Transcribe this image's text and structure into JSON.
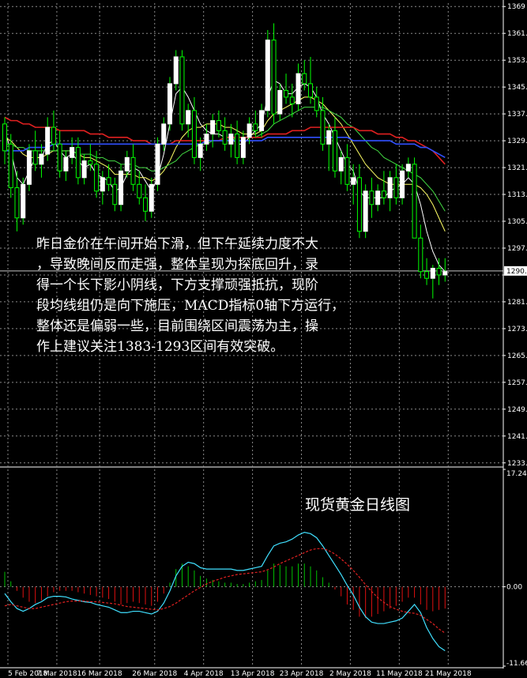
{
  "chart_data": [
    {
      "type": "candlestick",
      "instrument": "XAUUSD",
      "timeframe": "D1",
      "y_axis_ticks": [
        1369,
        1361,
        1353,
        1345,
        1337,
        1329,
        1321,
        1313,
        1305,
        1297,
        1289,
        1281,
        1273,
        1265,
        1257,
        1249,
        1241,
        1233
      ],
      "y_tick_labels": [
        "1369",
        "1361.",
        "1353.",
        "1345.",
        "1337.",
        "1329.",
        "1321.",
        "1313.",
        "1305.",
        "1297.",
        "",
        "1281.",
        "1273.",
        "1265.",
        "1257.",
        "1249.",
        "1241.",
        "1233."
      ],
      "ylim": [
        1232,
        1370
      ],
      "current_price": 1290.2,
      "current_price_label": "1290.",
      "x_tick_labels": [
        "5 Feb 2018",
        "7 Mar 2018",
        "16 Mar 2018",
        "26 Mar 2018",
        "4 Apr 2018",
        "13 Apr 2018",
        "23 Apr 2018",
        "2 May 2018",
        "11 May 2018",
        "21 May 2018"
      ],
      "candles_ohlc": [
        [
          1334,
          1336,
          1322,
          1326
        ],
        [
          1328,
          1331,
          1312,
          1315
        ],
        [
          1315,
          1320,
          1302,
          1306
        ],
        [
          1306,
          1318,
          1304,
          1316
        ],
        [
          1316,
          1328,
          1314,
          1326
        ],
        [
          1326,
          1332,
          1320,
          1322
        ],
        [
          1322,
          1328,
          1318,
          1325
        ],
        [
          1325,
          1336,
          1323,
          1333
        ],
        [
          1333,
          1338,
          1326,
          1328
        ],
        [
          1328,
          1332,
          1318,
          1320
        ],
        [
          1320,
          1326,
          1317,
          1324
        ],
        [
          1324,
          1330,
          1322,
          1327
        ],
        [
          1327,
          1330,
          1316,
          1318
        ],
        [
          1318,
          1325,
          1316,
          1323
        ],
        [
          1323,
          1328,
          1320,
          1322
        ],
        [
          1322,
          1326,
          1312,
          1314
        ],
        [
          1314,
          1320,
          1310,
          1318
        ],
        [
          1318,
          1322,
          1314,
          1316
        ],
        [
          1316,
          1318,
          1308,
          1310
        ],
        [
          1310,
          1322,
          1308,
          1320
        ],
        [
          1320,
          1326,
          1318,
          1324
        ],
        [
          1324,
          1328,
          1314,
          1316
        ],
        [
          1316,
          1320,
          1310,
          1312
        ],
        [
          1312,
          1316,
          1305,
          1308
        ],
        [
          1308,
          1318,
          1306,
          1316
        ],
        [
          1316,
          1330,
          1314,
          1328
        ],
        [
          1328,
          1336,
          1326,
          1334
        ],
        [
          1334,
          1348,
          1332,
          1346
        ],
        [
          1346,
          1356,
          1344,
          1354
        ],
        [
          1354,
          1356,
          1332,
          1334
        ],
        [
          1334,
          1340,
          1330,
          1338
        ],
        [
          1338,
          1342,
          1322,
          1324
        ],
        [
          1324,
          1330,
          1320,
          1328
        ],
        [
          1328,
          1334,
          1326,
          1331
        ],
        [
          1331,
          1337,
          1327,
          1335
        ],
        [
          1335,
          1338,
          1330,
          1332
        ],
        [
          1332,
          1336,
          1326,
          1328
        ],
        [
          1328,
          1334,
          1324,
          1331
        ],
        [
          1331,
          1335,
          1322,
          1324
        ],
        [
          1324,
          1332,
          1322,
          1330
        ],
        [
          1330,
          1336,
          1328,
          1334
        ],
        [
          1334,
          1338,
          1330,
          1332
        ],
        [
          1332,
          1340,
          1330,
          1338
        ],
        [
          1338,
          1362,
          1336,
          1359
        ],
        [
          1359,
          1364,
          1334,
          1337
        ],
        [
          1337,
          1346,
          1335,
          1344
        ],
        [
          1344,
          1349,
          1340,
          1342
        ],
        [
          1342,
          1346,
          1336,
          1340
        ],
        [
          1340,
          1352,
          1338,
          1349
        ],
        [
          1349,
          1353,
          1344,
          1346
        ],
        [
          1346,
          1354,
          1340,
          1342
        ],
        [
          1342,
          1345,
          1336,
          1338
        ],
        [
          1338,
          1342,
          1326,
          1328
        ],
        [
          1328,
          1334,
          1320,
          1332
        ],
        [
          1332,
          1336,
          1318,
          1320
        ],
        [
          1320,
          1326,
          1316,
          1324
        ],
        [
          1324,
          1328,
          1314,
          1316
        ],
        [
          1316,
          1322,
          1310,
          1318
        ],
        [
          1318,
          1322,
          1300,
          1302
        ],
        [
          1302,
          1316,
          1300,
          1314
        ],
        [
          1314,
          1318,
          1306,
          1310
        ],
        [
          1310,
          1316,
          1308,
          1314
        ],
        [
          1314,
          1320,
          1310,
          1312
        ],
        [
          1312,
          1320,
          1308,
          1318
        ],
        [
          1318,
          1322,
          1310,
          1312
        ],
        [
          1312,
          1322,
          1310,
          1320
        ],
        [
          1320,
          1324,
          1318,
          1322
        ],
        [
          1322,
          1324,
          1302,
          1300
        ],
        [
          1300,
          1304,
          1288,
          1290
        ],
        [
          1290,
          1294,
          1286,
          1288
        ],
        [
          1288,
          1292,
          1282,
          1291
        ],
        [
          1291,
          1294,
          1286,
          1289
        ],
        [
          1289,
          1294,
          1287,
          1290
        ]
      ],
      "ma_series": [
        {
          "color": "#ffffff",
          "values": [
            1332,
            1326,
            1318,
            1316,
            1320,
            1324,
            1324,
            1328,
            1329,
            1326,
            1324,
            1325,
            1323,
            1321,
            1322,
            1319,
            1318,
            1317,
            1314,
            1315,
            1319,
            1321,
            1320,
            1317,
            1314,
            1318,
            1325,
            1334,
            1343,
            1345,
            1342,
            1338,
            1334,
            1332,
            1331,
            1331,
            1330,
            1330,
            1328,
            1328,
            1330,
            1332,
            1334,
            1342,
            1347,
            1346,
            1343,
            1343,
            1345,
            1346,
            1345,
            1342,
            1337,
            1334,
            1330,
            1326,
            1322,
            1320,
            1314,
            1312,
            1312,
            1312,
            1312,
            1314,
            1315,
            1316,
            1318,
            1316,
            1310,
            1302,
            1296,
            1292,
            1290
          ]
        },
        {
          "color": "#ffff66",
          "values": [
            1330,
            1329,
            1327,
            1325,
            1324,
            1324,
            1324,
            1325,
            1326,
            1326,
            1326,
            1326,
            1325,
            1324,
            1324,
            1323,
            1322,
            1321,
            1319,
            1319,
            1319,
            1319,
            1318,
            1318,
            1317,
            1318,
            1320,
            1323,
            1327,
            1330,
            1332,
            1333,
            1333,
            1334,
            1334,
            1334,
            1333,
            1333,
            1332,
            1331,
            1331,
            1331,
            1332,
            1335,
            1337,
            1338,
            1339,
            1340,
            1341,
            1342,
            1342,
            1341,
            1340,
            1338,
            1336,
            1334,
            1331,
            1328,
            1325,
            1322,
            1320,
            1318,
            1317,
            1316,
            1316,
            1316,
            1316,
            1316,
            1315,
            1313,
            1310,
            1306,
            1302
          ]
        },
        {
          "color": "#44dd44",
          "values": [
            1328,
            1328,
            1327,
            1327,
            1326,
            1326,
            1326,
            1326,
            1326,
            1326,
            1326,
            1326,
            1325,
            1325,
            1325,
            1324,
            1324,
            1323,
            1323,
            1322,
            1322,
            1322,
            1321,
            1321,
            1320,
            1320,
            1321,
            1322,
            1323,
            1325,
            1326,
            1327,
            1328,
            1328,
            1329,
            1329,
            1329,
            1329,
            1330,
            1330,
            1330,
            1330,
            1331,
            1332,
            1334,
            1335,
            1336,
            1337,
            1338,
            1339,
            1339,
            1339,
            1339,
            1338,
            1337,
            1336,
            1334,
            1333,
            1331,
            1329,
            1327,
            1326,
            1324,
            1323,
            1322,
            1321,
            1320,
            1319,
            1318,
            1316,
            1314,
            1311,
            1308
          ]
        },
        {
          "color": "#e02020",
          "values": [
            1336,
            1335,
            1335,
            1334,
            1334,
            1333,
            1333,
            1333,
            1333,
            1332,
            1332,
            1332,
            1332,
            1332,
            1331,
            1331,
            1331,
            1330,
            1330,
            1330,
            1330,
            1329,
            1329,
            1329,
            1328,
            1328,
            1328,
            1328,
            1329,
            1329,
            1329,
            1329,
            1329,
            1329,
            1329,
            1329,
            1330,
            1330,
            1330,
            1330,
            1330,
            1330,
            1330,
            1331,
            1331,
            1331,
            1331,
            1332,
            1332,
            1332,
            1333,
            1333,
            1333,
            1333,
            1333,
            1333,
            1333,
            1333,
            1332,
            1332,
            1332,
            1331,
            1331,
            1331,
            1330,
            1330,
            1329,
            1329,
            1328,
            1327,
            1326,
            1324,
            1322
          ]
        },
        {
          "color": "#3050ff",
          "values": [
            1326,
            1326,
            1326,
            1326,
            1327,
            1327,
            1327,
            1327,
            1328,
            1328,
            1328,
            1328,
            1328,
            1328,
            1328,
            1328,
            1328,
            1328,
            1328,
            1328,
            1328,
            1328,
            1328,
            1328,
            1328,
            1328,
            1328,
            1328,
            1328,
            1328,
            1328,
            1328,
            1328,
            1329,
            1329,
            1329,
            1329,
            1329,
            1329,
            1329,
            1329,
            1329,
            1329,
            1330,
            1330,
            1330,
            1330,
            1330,
            1330,
            1330,
            1330,
            1330,
            1330,
            1330,
            1330,
            1330,
            1330,
            1329,
            1329,
            1329,
            1329,
            1329,
            1329,
            1329,
            1328,
            1328,
            1328,
            1328,
            1327,
            1327,
            1326,
            1325,
            1324
          ]
        }
      ]
    },
    {
      "type": "macd",
      "y_tick_labels": [
        "17.24",
        "0.00",
        "-11.66"
      ],
      "ylim": [
        -11.66,
        17.24
      ],
      "histogram": [
        2.2,
        0.8,
        -0.6,
        -1.6,
        -2.2,
        -2.4,
        -2.0,
        -1.4,
        -0.8,
        -0.6,
        -0.6,
        -0.6,
        -0.8,
        -1.0,
        -1.2,
        -1.4,
        -1.6,
        -1.8,
        -2.2,
        -2.6,
        -2.4,
        -2.2,
        -2.4,
        -2.6,
        -2.8,
        -2.2,
        -1.0,
        0.6,
        2.6,
        3.4,
        3.0,
        2.4,
        1.6,
        1.2,
        1.0,
        0.8,
        0.6,
        0.6,
        0.4,
        0.4,
        0.6,
        0.8,
        1.0,
        2.4,
        3.4,
        3.2,
        3.0,
        3.0,
        3.4,
        3.4,
        3.0,
        2.4,
        1.4,
        0.6,
        -0.4,
        -1.4,
        -2.6,
        -3.4,
        -4.4,
        -4.6,
        -4.4,
        -4.0,
        -3.6,
        -3.2,
        -2.8,
        -2.2,
        -1.6,
        -1.6,
        -2.6,
        -3.4,
        -3.6,
        -3.4,
        -3.2
      ],
      "macd_line": [
        -1.0,
        -2.2,
        -3.2,
        -3.6,
        -3.2,
        -2.6,
        -2.2,
        -1.6,
        -1.4,
        -1.4,
        -1.5,
        -1.8,
        -2.0,
        -2.2,
        -2.3,
        -2.6,
        -2.8,
        -3.0,
        -3.4,
        -3.8,
        -3.8,
        -3.6,
        -3.6,
        -3.8,
        -4.0,
        -3.6,
        -2.4,
        -0.6,
        1.6,
        3.0,
        3.6,
        3.4,
        2.8,
        2.6,
        2.6,
        2.6,
        2.6,
        2.6,
        2.4,
        2.4,
        2.6,
        2.8,
        3.0,
        4.6,
        6.0,
        6.4,
        6.6,
        7.0,
        7.6,
        8.0,
        7.8,
        7.2,
        6.0,
        4.6,
        3.2,
        1.8,
        0.2,
        -1.2,
        -3.0,
        -4.4,
        -5.2,
        -5.4,
        -5.4,
        -5.2,
        -5.0,
        -4.6,
        -3.6,
        -2.6,
        -3.8,
        -6.0,
        -7.6,
        -8.8,
        -9.4
      ],
      "signal_line": [
        -2.8,
        -2.6,
        -2.8,
        -3.0,
        -3.2,
        -3.2,
        -3.0,
        -2.8,
        -2.6,
        -2.4,
        -2.2,
        -2.1,
        -2.1,
        -2.1,
        -2.2,
        -2.2,
        -2.3,
        -2.4,
        -2.5,
        -2.7,
        -2.9,
        -3.0,
        -3.1,
        -3.2,
        -3.3,
        -3.4,
        -3.2,
        -2.9,
        -2.4,
        -1.8,
        -1.2,
        -0.6,
        -0.1,
        0.4,
        0.8,
        1.1,
        1.4,
        1.6,
        1.8,
        1.9,
        2.0,
        2.1,
        2.2,
        2.5,
        2.9,
        3.4,
        3.8,
        4.2,
        4.6,
        5.0,
        5.4,
        5.6,
        5.6,
        5.3,
        4.8,
        4.1,
        3.3,
        2.4,
        1.4,
        0.3,
        -0.7,
        -1.6,
        -2.3,
        -2.9,
        -3.3,
        -3.6,
        -3.8,
        -3.9,
        -4.2,
        -4.8,
        -5.4,
        -6.2,
        -6.8
      ]
    }
  ],
  "annotation": {
    "lines": [
      "昨日金价在午间开始下滑，但下午延续力度不大",
      "，导致晚间反而走强，整体呈现为探底回升，录",
      "得一个长下影小阴线，下方支撑顽强抵抗，现阶",
      "段均线组仍是向下施压，MACD指标0轴下方运行，",
      "整体还是偏弱一些，目前围绕区间震荡为主，操",
      "作上建议关注1383-1293区间有效突破。"
    ]
  },
  "macd_title": "现货黄金日线图",
  "colors": {
    "background": "#000000",
    "bull_body": "#ffffff",
    "bear_body": "#000000",
    "candle_wick": "#00ff00",
    "grid": "#8a8a8a",
    "hist_pos": "#00c000",
    "hist_neg": "#e01010",
    "macd_line": "#40e0ff",
    "signal_line": "#e02020"
  }
}
